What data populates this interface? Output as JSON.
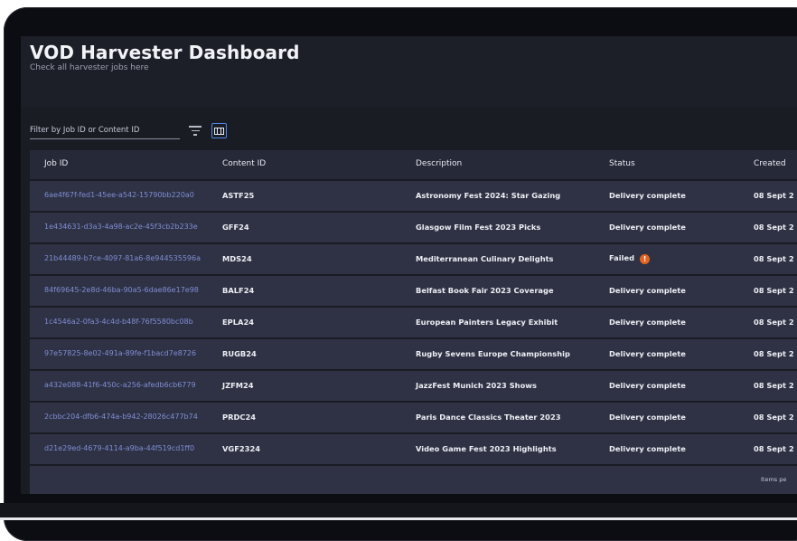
{
  "header": {
    "title": "VOD Harvester Dashboard",
    "subtitle": "Check all harvester jobs here"
  },
  "filter": {
    "placeholder": "Filter by Job ID or Content ID",
    "filter_icon": "filter-lines-icon",
    "columns_icon": "columns-view-icon"
  },
  "table": {
    "columns": [
      "Job ID",
      "Content ID",
      "Description",
      "Status",
      "Created"
    ],
    "rows": [
      {
        "job_id": "6ae4f67f-fed1-45ee-a542-15790bb220a0",
        "content_id": "ASTF25",
        "description": "Astronomy Fest 2024: Star Gazing",
        "status": "Delivery complete",
        "created": "08 Sept 2"
      },
      {
        "job_id": "1e434631-d3a3-4a98-ac2e-45f3cb2b233e",
        "content_id": "GFF24",
        "description": "Glasgow Film Fest 2023 Picks",
        "status": "Delivery complete",
        "created": "08 Sept 2"
      },
      {
        "job_id": "21b44489-b7ce-4097-81a6-8e944535596a",
        "content_id": "MDS24",
        "description": "Mediterranean Culinary Delights",
        "status": "Failed",
        "created": "08 Sept 2"
      },
      {
        "job_id": "84f69645-2e8d-46ba-90a5-6dae86e17e98",
        "content_id": "BALF24",
        "description": "Belfast Book Fair 2023 Coverage",
        "status": "Delivery complete",
        "created": "08 Sept 2"
      },
      {
        "job_id": "1c4546a2-0fa3-4c4d-b48f-76f5580bc08b",
        "content_id": "EPLA24",
        "description": "European Painters Legacy Exhibit",
        "status": "Delivery complete",
        "created": "08 Sept 2"
      },
      {
        "job_id": "97e57825-8e02-491a-89fe-f1bacd7e8726",
        "content_id": "RUGB24",
        "description": "Rugby Sevens Europe Championship",
        "status": "Delivery complete",
        "created": "08 Sept 2"
      },
      {
        "job_id": "a432e088-41f6-450c-a256-afedb6cb6779",
        "content_id": "JZFM24",
        "description": "JazzFest Munich 2023 Shows",
        "status": "Delivery complete",
        "created": "08 Sept 2"
      },
      {
        "job_id": "2cbbc204-dfb6-474a-b942-28026c477b74",
        "content_id": "PRDC24",
        "description": "Paris Dance Classics Theater 2023",
        "status": "Delivery complete",
        "created": "08 Sept 2"
      },
      {
        "job_id": "d21e29ed-4679-4114-a9ba-44f519cd1ff0",
        "content_id": "VGF2324",
        "description": "Video Game Fest 2023 Highlights",
        "status": "Delivery complete",
        "created": "08 Sept 2"
      }
    ]
  },
  "footer": {
    "items_label": "Items pe"
  },
  "colors": {
    "job_id_link": "#7f8ed6",
    "failed_badge": "#e2641e",
    "accent": "#4c86e6"
  }
}
